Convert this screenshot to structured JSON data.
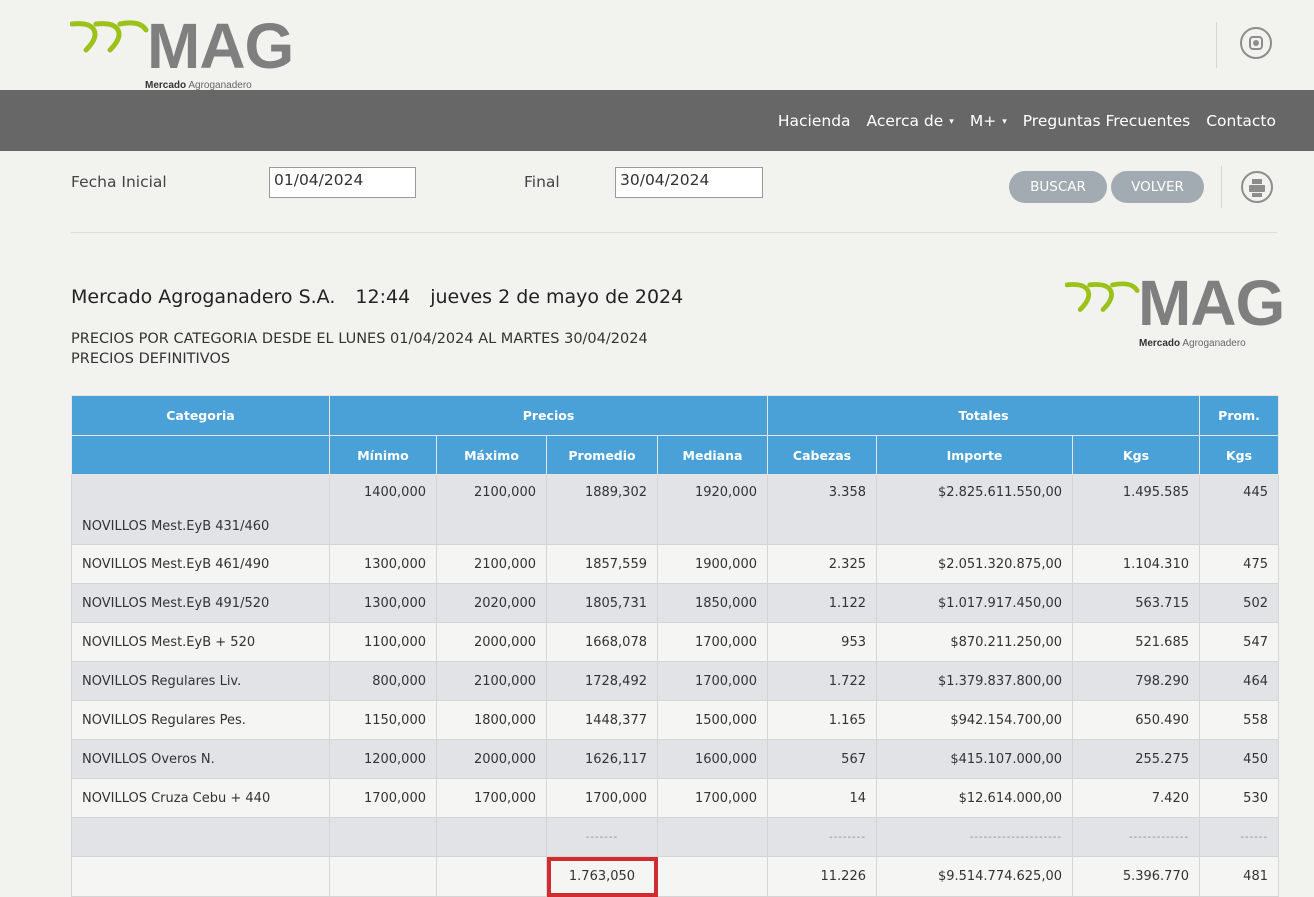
{
  "header": {
    "brand_name": "MAG",
    "brand_sub_bold": "Mercado",
    "brand_sub_rest": "Agroganadero"
  },
  "nav": {
    "items": [
      {
        "label": "Hacienda"
      },
      {
        "label": "Acerca de",
        "caret": "▾"
      },
      {
        "label": "M+",
        "caret": "▾"
      },
      {
        "label": "Preguntas Frecuentes"
      },
      {
        "label": "Contacto"
      }
    ]
  },
  "search": {
    "fecha_inicial_label": "Fecha Inicial",
    "fecha_inicial_value": "01/04/2024",
    "final_label": "Final",
    "final_value": "30/04/2024",
    "buscar_label": "BUSCAR",
    "volver_label": "VOLVER"
  },
  "report": {
    "company": "Mercado Agroganadero S.A.",
    "time": "12:44",
    "date": "jueves 2 de mayo de 2024",
    "subtitle1": "PRECIOS POR CATEGORIA DESDE EL LUNES 01/04/2024 AL MARTES 30/04/2024",
    "subtitle2": "PRECIOS DEFINITIVOS"
  },
  "table": {
    "group_headers": {
      "categoria": "Categoria",
      "precios": "Precios",
      "totales": "Totales",
      "prom": "Prom."
    },
    "columns": [
      "Mínimo",
      "Máximo",
      "Promedio",
      "Mediana",
      "Cabezas",
      "Importe",
      "Kgs",
      "Kgs"
    ],
    "rows": [
      {
        "cat": "NOVILLOS Mest.EyB 431/460",
        "min": "1400,000",
        "max": "2100,000",
        "prom": "1889,302",
        "med": "1920,000",
        "cab": "3.358",
        "imp": "$2.825.611.550,00",
        "kgs": "1.495.585",
        "pk": "445"
      },
      {
        "cat": "NOVILLOS Mest.EyB 461/490",
        "min": "1300,000",
        "max": "2100,000",
        "prom": "1857,559",
        "med": "1900,000",
        "cab": "2.325",
        "imp": "$2.051.320.875,00",
        "kgs": "1.104.310",
        "pk": "475"
      },
      {
        "cat": "NOVILLOS Mest.EyB 491/520",
        "min": "1300,000",
        "max": "2020,000",
        "prom": "1805,731",
        "med": "1850,000",
        "cab": "1.122",
        "imp": "$1.017.917.450,00",
        "kgs": "563.715",
        "pk": "502"
      },
      {
        "cat": "NOVILLOS Mest.EyB + 520",
        "min": "1100,000",
        "max": "2000,000",
        "prom": "1668,078",
        "med": "1700,000",
        "cab": "953",
        "imp": "$870.211.250,00",
        "kgs": "521.685",
        "pk": "547"
      },
      {
        "cat": "NOVILLOS Regulares Liv.",
        "min": "800,000",
        "max": "2100,000",
        "prom": "1728,492",
        "med": "1700,000",
        "cab": "1.722",
        "imp": "$1.379.837.800,00",
        "kgs": "798.290",
        "pk": "464"
      },
      {
        "cat": "NOVILLOS Regulares Pes.",
        "min": "1150,000",
        "max": "1800,000",
        "prom": "1448,377",
        "med": "1500,000",
        "cab": "1.165",
        "imp": "$942.154.700,00",
        "kgs": "650.490",
        "pk": "558"
      },
      {
        "cat": "NOVILLOS Overos N.",
        "min": "1200,000",
        "max": "2000,000",
        "prom": "1626,117",
        "med": "1600,000",
        "cab": "567",
        "imp": "$415.107.000,00",
        "kgs": "255.275",
        "pk": "450"
      },
      {
        "cat": "NOVILLOS Cruza Cebu + 440",
        "min": "1700,000",
        "max": "1700,000",
        "prom": "1700,000",
        "med": "1700,000",
        "cab": "14",
        "imp": "$12.614.000,00",
        "kgs": "7.420",
        "pk": "530"
      }
    ],
    "dashes": {
      "prom": "-------",
      "cab": "--------",
      "imp": "--------------------",
      "kgs": "-------------",
      "pk": "------"
    },
    "totals": {
      "prom": "1.763,050",
      "cab": "11.226",
      "imp": "$9.514.774.625,00",
      "kgs": "5.396.770",
      "pk": "481"
    }
  },
  "colors": {
    "navbar": "#676767",
    "table_header": "#4aa1d8",
    "logo_green": "#9cc21a",
    "highlight": "#d12c2f",
    "button": "#a2aab2"
  },
  "icons": [
    "mag-logo-icon",
    "instagram-icon",
    "printer-icon"
  ]
}
